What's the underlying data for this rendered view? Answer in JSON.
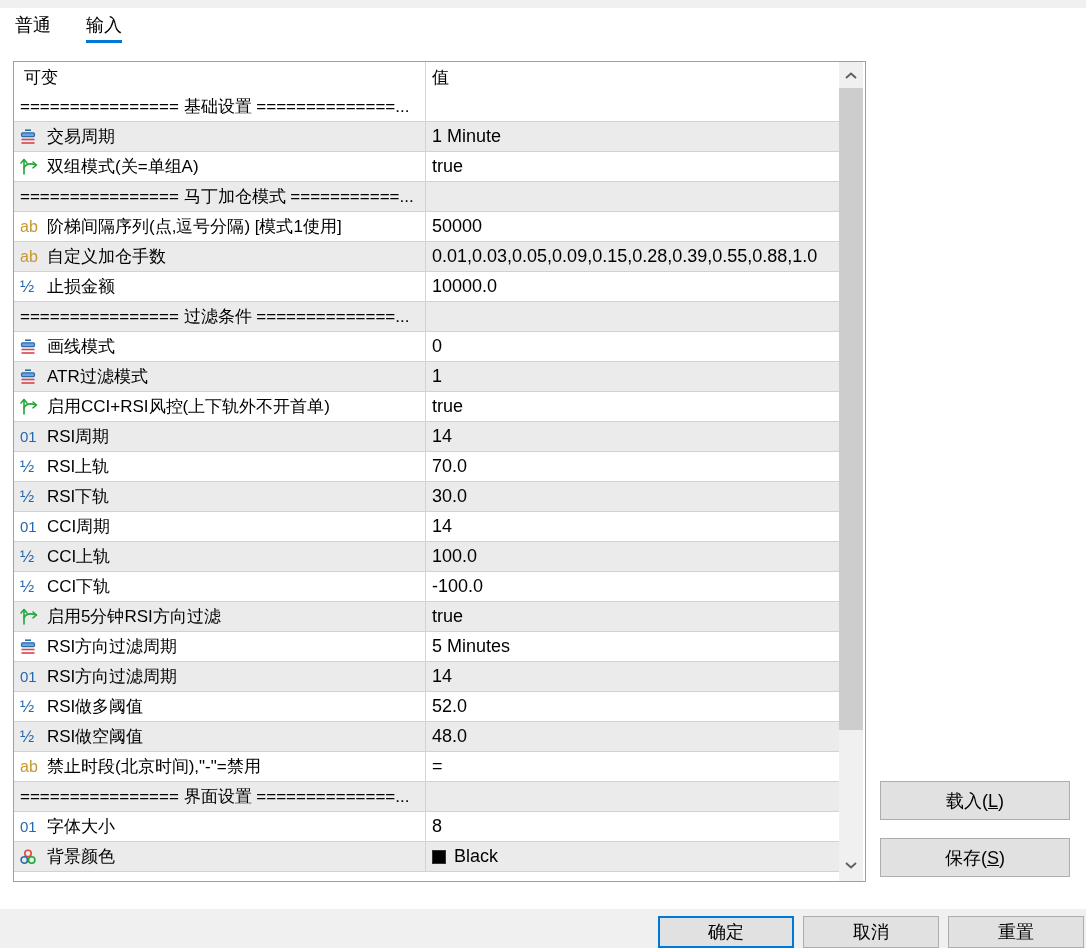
{
  "tabs": [
    {
      "label": "普通",
      "selected": false
    },
    {
      "label": "输入",
      "selected": true
    }
  ],
  "table": {
    "columns": [
      "可变",
      "值"
    ],
    "rows": [
      {
        "kind": "separator",
        "label": "================ 基础设置 ==============..."
      },
      {
        "kind": "enum",
        "name": "交易周期",
        "value": "1 Minute"
      },
      {
        "kind": "bool",
        "name": "双组模式(关=单组A)",
        "value": "true"
      },
      {
        "kind": "separator",
        "label": "================ 马丁加仓模式 ===========..."
      },
      {
        "kind": "string",
        "icon": "ab",
        "name": "阶梯间隔序列(点,逗号分隔) [模式1使用]",
        "value": "50000"
      },
      {
        "kind": "string",
        "icon": "ab",
        "name": "自定义加仓手数",
        "value": "0.01,0.03,0.05,0.09,0.15,0.28,0.39,0.55,0.88,1.0"
      },
      {
        "kind": "double",
        "icon": "½",
        "name": "止损金额",
        "value": "10000.0"
      },
      {
        "kind": "separator",
        "label": "================ 过滤条件 ==============..."
      },
      {
        "kind": "enum",
        "name": "画线模式",
        "value": "0"
      },
      {
        "kind": "enum",
        "name": "ATR过滤模式",
        "value": "1"
      },
      {
        "kind": "bool",
        "name": "启用CCI+RSI风控(上下轨外不开首单)",
        "value": "true"
      },
      {
        "kind": "int",
        "icon": "01",
        "name": "RSI周期",
        "value": "14"
      },
      {
        "kind": "double",
        "icon": "½",
        "name": "RSI上轨",
        "value": "70.0"
      },
      {
        "kind": "double",
        "icon": "½",
        "name": "RSI下轨",
        "value": "30.0"
      },
      {
        "kind": "int",
        "icon": "01",
        "name": "CCI周期",
        "value": "14"
      },
      {
        "kind": "double",
        "icon": "½",
        "name": "CCI上轨",
        "value": "100.0"
      },
      {
        "kind": "double",
        "icon": "½",
        "name": "CCI下轨",
        "value": "-100.0"
      },
      {
        "kind": "bool",
        "name": "启用5分钟RSI方向过滤",
        "value": "true"
      },
      {
        "kind": "enum",
        "name": "RSI方向过滤周期",
        "value": "5 Minutes"
      },
      {
        "kind": "int",
        "icon": "01",
        "name": "RSI方向过滤周期",
        "value": "14"
      },
      {
        "kind": "double",
        "icon": "½",
        "name": "RSI做多阈值",
        "value": "52.0"
      },
      {
        "kind": "double",
        "icon": "½",
        "name": "RSI做空阈值",
        "value": "48.0"
      },
      {
        "kind": "string",
        "icon": "ab",
        "name": "禁止时段(北京时间),\"-\"=禁用",
        "value": "="
      },
      {
        "kind": "separator",
        "label": "================ 界面设置 ==============..."
      },
      {
        "kind": "int",
        "icon": "01",
        "name": "字体大小",
        "value": "8"
      },
      {
        "kind": "color",
        "name": "背景颜色",
        "value": "Black",
        "color": "#000000"
      }
    ]
  },
  "side_buttons": [
    {
      "text_before": "载入(",
      "mnemonic": "L",
      "text_after": ")"
    },
    {
      "text_before": "保存(",
      "mnemonic": "S",
      "text_after": ")"
    }
  ],
  "dialog_buttons": [
    {
      "label": "确定",
      "default": true
    },
    {
      "label": "取消",
      "default": false
    },
    {
      "label": "重置",
      "default": false
    }
  ]
}
